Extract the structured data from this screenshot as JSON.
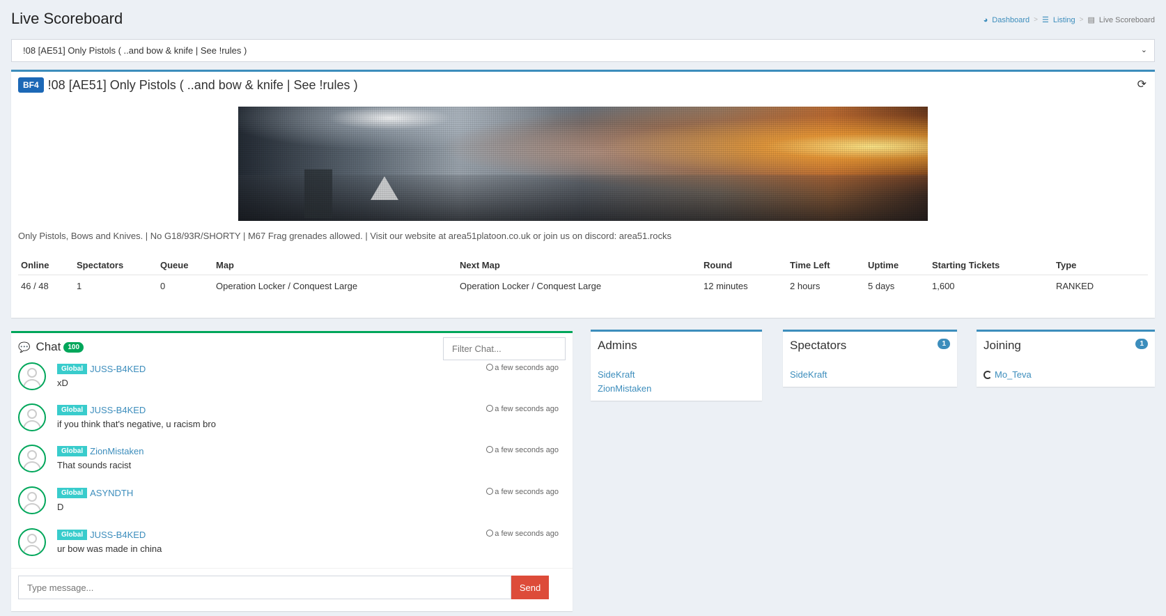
{
  "header": {
    "title": "Live Scoreboard",
    "breadcrumb": [
      {
        "label": "Dashboard",
        "icon": "dashboard-icon"
      },
      {
        "label": "Listing",
        "icon": "list-icon"
      },
      {
        "label": "Live Scoreboard",
        "icon": "table-icon"
      }
    ]
  },
  "server_select": {
    "selected": "!08 [AE51] Only Pistols ( ..and bow & knife | See !rules )"
  },
  "server": {
    "game_badge": "BF4",
    "name": "!08 [AE51] Only Pistols ( ..and bow & knife | See !rules )",
    "description": "Only Pistols, Bows and Knives. | No G18/93R/SHORTY | M67 Frag grenades allowed. | Visit our website at area51platoon.co.uk or join us on discord: area51.rocks",
    "columns": [
      "Online",
      "Spectators",
      "Queue",
      "Map",
      "Next Map",
      "Round",
      "Time Left",
      "Uptime",
      "Starting Tickets",
      "Type"
    ],
    "values": [
      "46 / 48",
      "1",
      "0",
      "Operation Locker / Conquest Large",
      "Operation Locker / Conquest Large",
      "12 minutes",
      "2 hours",
      "5 days",
      "1,600",
      "RANKED"
    ]
  },
  "chat": {
    "title": "Chat",
    "count": "100",
    "filter_placeholder": "Filter Chat...",
    "messages": [
      {
        "channel": "Global",
        "author": "JUSS-B4KED",
        "text": "xD",
        "time": "a few seconds ago"
      },
      {
        "channel": "Global",
        "author": "JUSS-B4KED",
        "text": "if you think that's negative, u racism bro",
        "time": "a few seconds ago"
      },
      {
        "channel": "Global",
        "author": "ZionMistaken",
        "text": "That sounds racist",
        "time": "a few seconds ago"
      },
      {
        "channel": "Global",
        "author": "ASYNDTH",
        "text": "D",
        "time": "a few seconds ago"
      },
      {
        "channel": "Global",
        "author": "JUSS-B4KED",
        "text": "ur bow was made in china",
        "time": "a few seconds ago"
      }
    ],
    "input_placeholder": "Type message...",
    "send_label": "Send"
  },
  "admins": {
    "title": "Admins",
    "names": [
      "SideKraft",
      "ZionMistaken"
    ]
  },
  "spectators": {
    "title": "Spectators",
    "count": "1",
    "names": [
      "SideKraft"
    ]
  },
  "joining": {
    "title": "Joining",
    "count": "1",
    "names": [
      "Mo_Teva"
    ]
  },
  "colors": {
    "primary": "#3c8dbc",
    "success": "#00a65a",
    "danger": "#dd4b39",
    "info": "#39cccc",
    "bf4_badge": "#1c68b6",
    "background": "#ecf0f5"
  }
}
